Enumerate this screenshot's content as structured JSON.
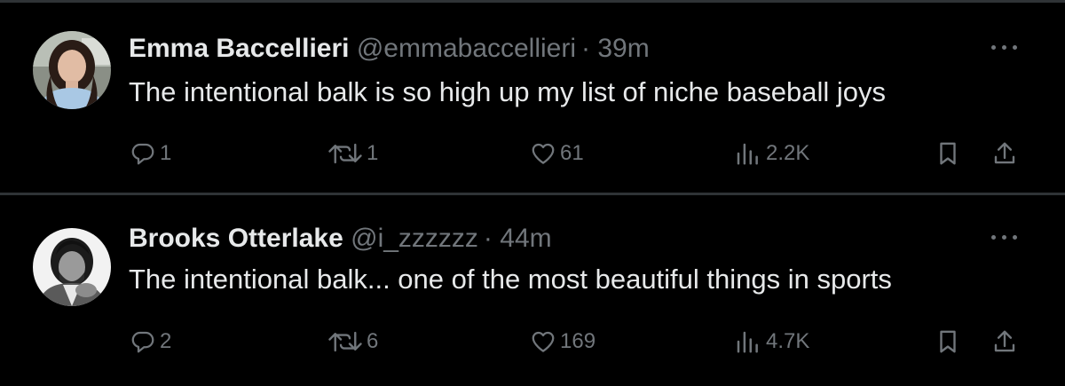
{
  "tweets": [
    {
      "display_name": "Emma Baccellieri",
      "handle": "@emmabaccellieri",
      "separator": "·",
      "time": "39m",
      "text": "The intentional balk is so high up my list of niche baseball joys",
      "replies": "1",
      "retweets": "1",
      "likes": "61",
      "views": "2.2K"
    },
    {
      "display_name": "Brooks Otterlake",
      "handle": "@i_zzzzzz",
      "separator": "·",
      "time": "44m",
      "text": "The intentional balk... one of the most beautiful things in sports",
      "replies": "2",
      "retweets": "6",
      "likes": "169",
      "views": "4.7K"
    }
  ],
  "icons": {
    "reply": "reply-icon",
    "retweet": "retweet-icon",
    "like": "heart-icon",
    "views": "views-icon",
    "bookmark": "bookmark-icon",
    "share": "share-icon",
    "more": "more-icon"
  },
  "colors": {
    "background": "#000000",
    "text": "#e7e9ea",
    "muted": "#71767b",
    "divider": "#2f3336"
  }
}
